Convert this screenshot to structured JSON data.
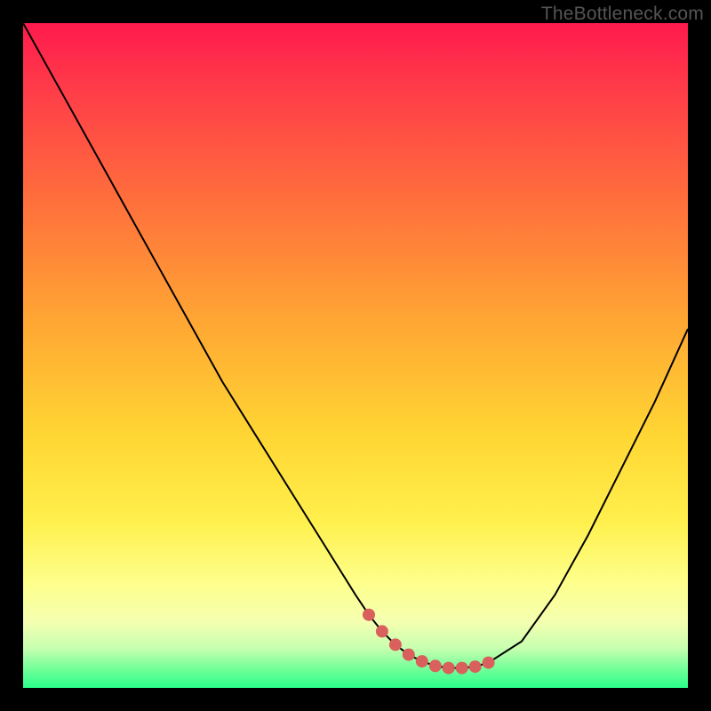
{
  "attribution": "TheBottleneck.com",
  "colors": {
    "frame": "#000000",
    "curve_stroke": "#000000",
    "marker_fill": "#d9605c",
    "marker_stroke": "#d9605c"
  },
  "chart_data": {
    "type": "line",
    "title": "",
    "xlabel": "",
    "ylabel": "",
    "xlim": [
      0,
      100
    ],
    "ylim": [
      0,
      100
    ],
    "grid": false,
    "legend": false,
    "annotations": [],
    "series": [
      {
        "name": "bottleneck-curve",
        "x": [
          0,
          5,
          10,
          15,
          20,
          25,
          30,
          35,
          40,
          45,
          50,
          52,
          54,
          56,
          58,
          60,
          62,
          64,
          66,
          68,
          70,
          75,
          80,
          85,
          90,
          95,
          100
        ],
        "y": [
          100,
          91,
          82,
          73,
          64,
          55,
          46,
          38,
          30,
          22,
          14,
          11,
          8.5,
          6.5,
          5,
          4,
          3.3,
          3,
          3,
          3.2,
          3.8,
          7,
          14,
          23,
          33,
          43,
          54
        ]
      },
      {
        "name": "optimal-range-markers",
        "x": [
          52,
          54,
          56,
          58,
          60,
          62,
          64,
          66,
          68,
          70
        ],
        "y": [
          11,
          8.5,
          6.5,
          5,
          4,
          3.3,
          3,
          3,
          3.2,
          3.8
        ]
      }
    ]
  }
}
